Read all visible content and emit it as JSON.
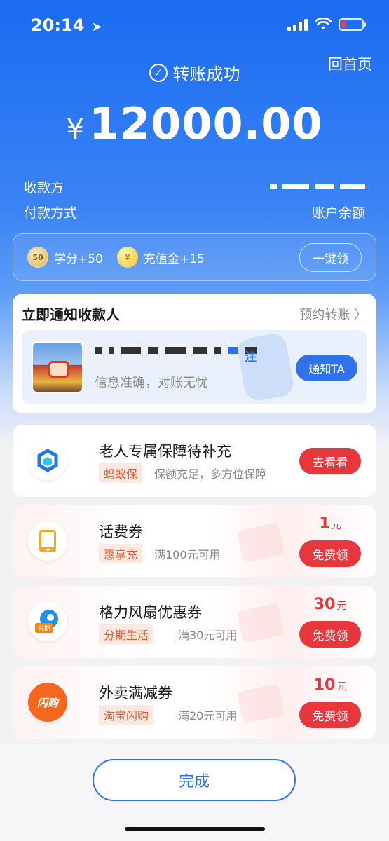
{
  "status_bar": {
    "time": "20:14"
  },
  "header": {
    "title": "转账成功",
    "home_link": "回首页"
  },
  "amount": {
    "currency": "¥",
    "value": "12000.00"
  },
  "info": {
    "payee_label": "收款方",
    "payment_method_label": "付款方式",
    "payment_method_value": "账户余额"
  },
  "rewards": {
    "score_coin": "50",
    "score_label": "学分+50",
    "gold_label": "充值金+15",
    "claim_label": "一键领"
  },
  "notify": {
    "title": "立即通知收款人",
    "schedule_link": "预约转账",
    "name_suffix": "注",
    "subtitle": "信息准确，对账无忧",
    "button": "通知TA"
  },
  "offers": [
    {
      "title": "老人专属保障待补充",
      "tag": "蚂蚁保",
      "desc": "保额充足，多方位保障",
      "button": "去看看"
    },
    {
      "title": "话费券",
      "tag": "惠享充",
      "desc": "满100元可用",
      "price": "1",
      "unit": "元",
      "button": "免费领"
    },
    {
      "title": "格力风扇优惠券",
      "tag": "分期生活",
      "desc": "满30元可用",
      "price": "30",
      "unit": "元",
      "button": "免费领",
      "icon_text": "分期"
    },
    {
      "title": "外卖满减券",
      "tag": "淘宝闪购",
      "desc": "满20元可用",
      "price": "10",
      "unit": "元",
      "button": "免费领",
      "icon_text": "闪购"
    }
  ],
  "footer": {
    "done_label": "完成"
  },
  "colors": {
    "primary_blue": "#2f72ea",
    "red": "#e8363d",
    "tag_orange": "#e4572e"
  }
}
